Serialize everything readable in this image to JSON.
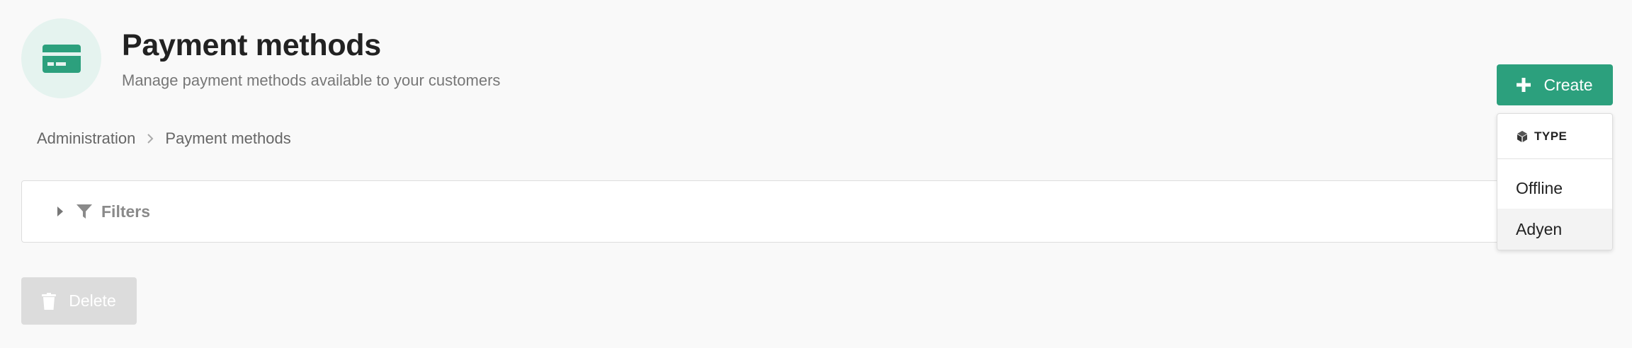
{
  "header": {
    "title": "Payment methods",
    "subtitle": "Manage payment methods available to your customers",
    "icon": "credit-card-icon",
    "icon_color": "#2ca07d"
  },
  "breadcrumb": {
    "items": [
      "Administration",
      "Payment methods"
    ]
  },
  "filters": {
    "label": "Filters"
  },
  "actions": {
    "delete_label": "Delete",
    "create_label": "Create"
  },
  "create_menu": {
    "header": "TYPE",
    "options": [
      "Offline",
      "Adyen"
    ],
    "highlighted": "Adyen"
  },
  "colors": {
    "accent": "#2ca07d",
    "icon_bg": "#e5f3ef",
    "disabled": "#dcdcdc"
  }
}
